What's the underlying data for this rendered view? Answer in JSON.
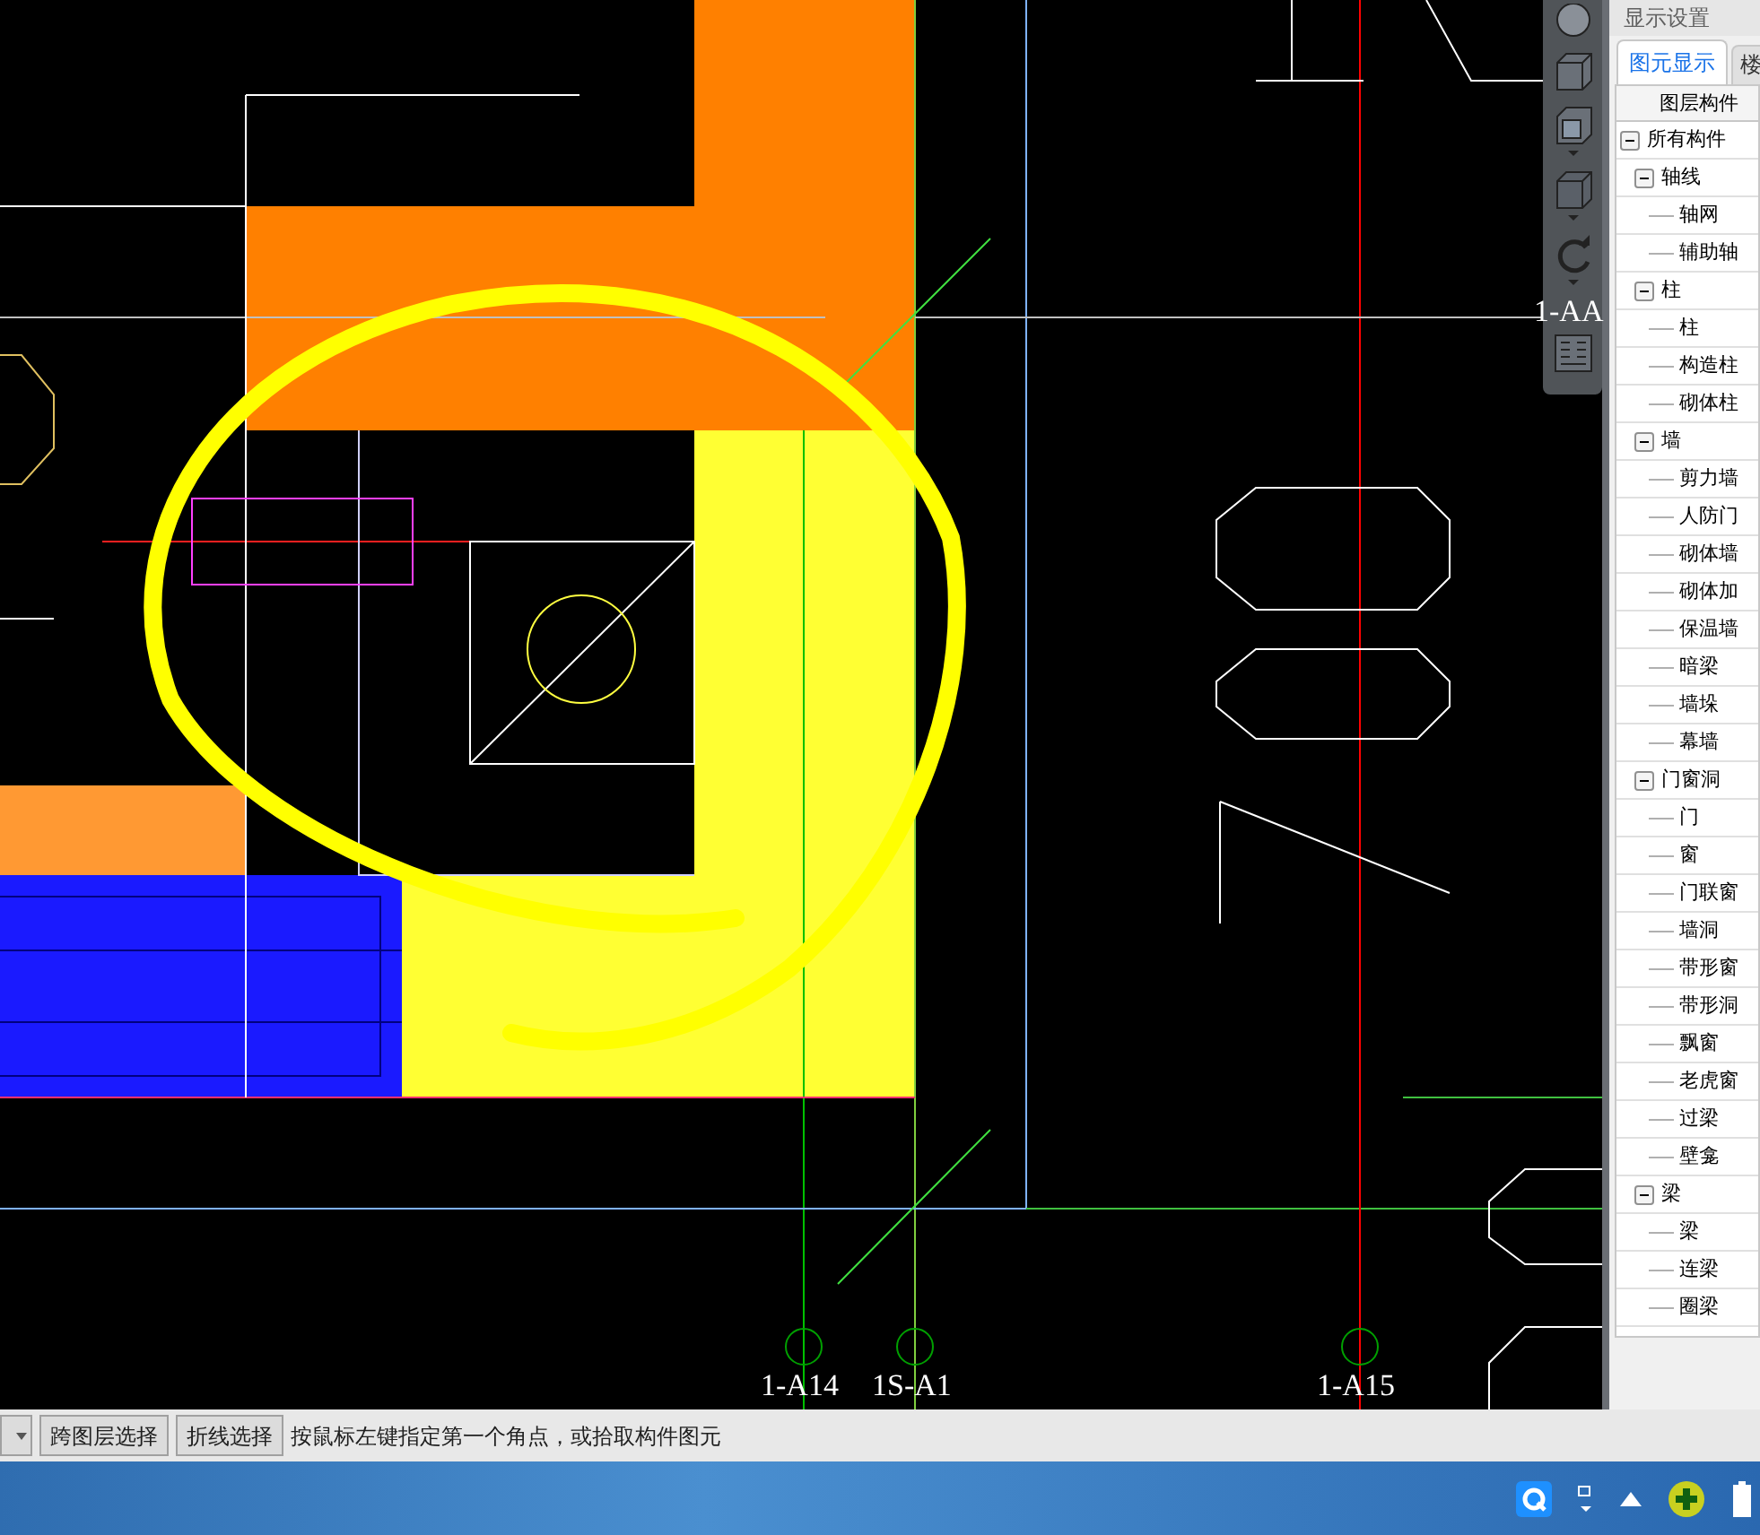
{
  "canvas": {
    "axis_labels": [
      {
        "text": "1-A14",
        "kind": "bottom"
      },
      {
        "text": "1S-A1",
        "kind": "bottom"
      },
      {
        "text": "1-A15",
        "kind": "bottom"
      },
      {
        "text": "1-AA",
        "kind": "side"
      }
    ]
  },
  "panel": {
    "title": "显示设置",
    "tabs": [
      {
        "label": "图元显示",
        "selected": true
      },
      {
        "label": "楼",
        "selected": false
      }
    ],
    "column": "图层构件",
    "tree": [
      {
        "label": "所有构件",
        "expanded": true,
        "children": [
          {
            "label": "轴线",
            "expanded": true,
            "children": [
              {
                "label": "轴网"
              },
              {
                "label": "辅助轴"
              }
            ]
          },
          {
            "label": "柱",
            "expanded": true,
            "children": [
              {
                "label": "柱"
              },
              {
                "label": "构造柱"
              },
              {
                "label": "砌体柱"
              }
            ]
          },
          {
            "label": "墙",
            "expanded": true,
            "children": [
              {
                "label": "剪力墙"
              },
              {
                "label": "人防门"
              },
              {
                "label": "砌体墙"
              },
              {
                "label": "砌体加"
              },
              {
                "label": "保温墙"
              },
              {
                "label": "暗梁"
              },
              {
                "label": "墙垛"
              },
              {
                "label": "幕墙"
              }
            ]
          },
          {
            "label": "门窗洞",
            "expanded": true,
            "children": [
              {
                "label": "门"
              },
              {
                "label": "窗"
              },
              {
                "label": "门联窗"
              },
              {
                "label": "墙洞"
              },
              {
                "label": "带形窗"
              },
              {
                "label": "带形洞"
              },
              {
                "label": "飘窗"
              },
              {
                "label": "老虎窗"
              },
              {
                "label": "过梁"
              },
              {
                "label": "壁龛"
              }
            ]
          },
          {
            "label": "梁",
            "expanded": true,
            "children": [
              {
                "label": "梁"
              },
              {
                "label": "连梁"
              },
              {
                "label": "圈梁"
              }
            ]
          }
        ]
      }
    ]
  },
  "status_bar": {
    "buttons": [
      "跨图层选择",
      "折线选择"
    ],
    "prompt": "按鼠标左键指定第一个角点，或拾取构件图元"
  }
}
